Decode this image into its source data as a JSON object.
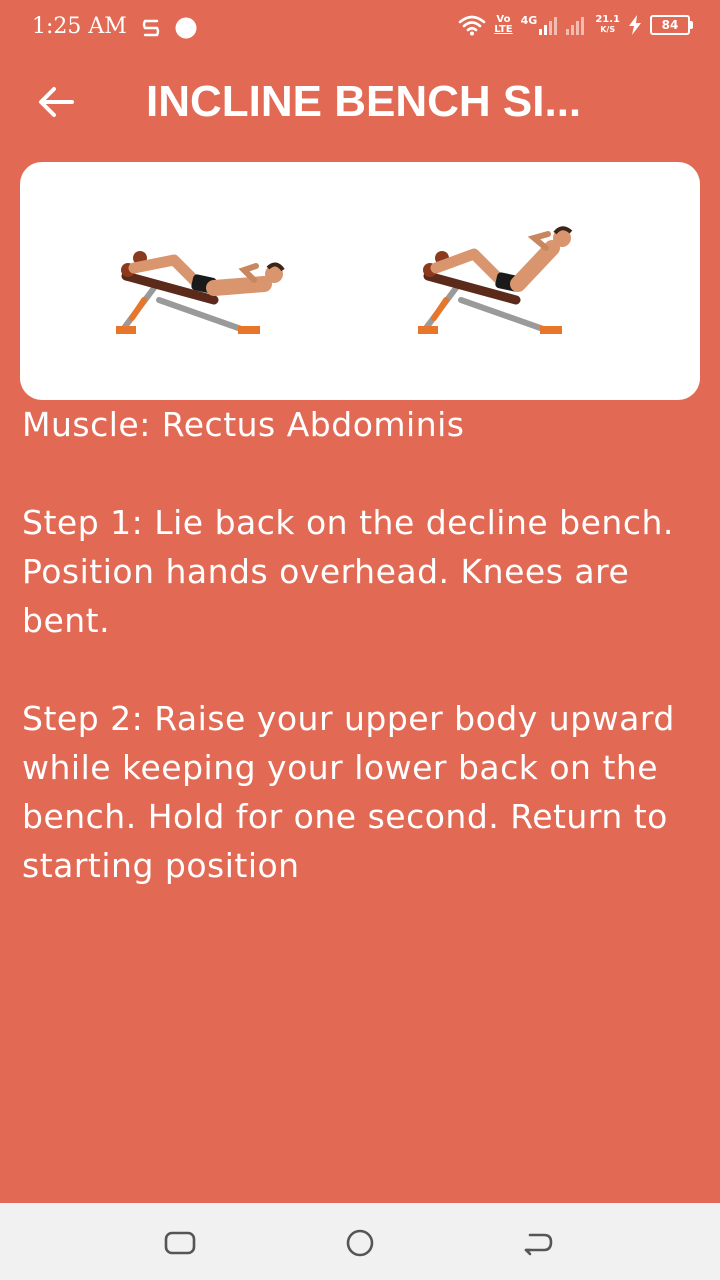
{
  "status_bar": {
    "time": "1:25 AM",
    "net_volte_top": "Vo",
    "net_volte_bottom": "LTE",
    "net_4g": "4G",
    "speed_value": "21.1",
    "speed_unit": "K/S",
    "battery": "84"
  },
  "header": {
    "title": "INCLINE BENCH SI..."
  },
  "content": {
    "muscle": "Muscle: Rectus Abdominis",
    "step1": "Step 1: Lie back on the decline bench. Position hands overhead. Knees are bent.",
    "step2": "Step 2: Raise your upper body upward while keeping your lower back on the bench. Hold for one second. Return to starting position"
  },
  "icons": {
    "back": "arrow-left-icon",
    "wifi": "wifi-icon",
    "signal": "signal-icon",
    "charging": "charging-bolt-icon",
    "recents": "recents-icon",
    "home": "home-icon",
    "nav_back": "back-icon"
  },
  "colors": {
    "background": "#E26A55",
    "card": "#FFFFFF",
    "nav_bar": "#F1F1F1"
  }
}
